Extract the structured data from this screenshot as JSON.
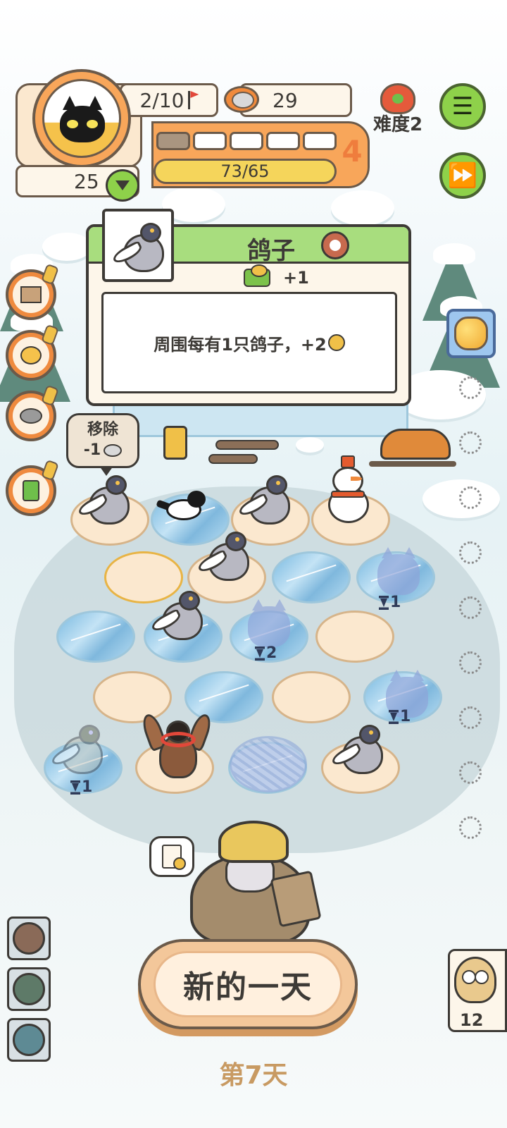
{
  "hud": {
    "level": "2/10",
    "coins": "29",
    "difficulty": "难度2",
    "week_number": "4",
    "progress": "73/65",
    "progress_fraction": 1.0,
    "week_segments_filled": 1,
    "week_segments_total": 5,
    "food": "25"
  },
  "card": {
    "title": "鸽子",
    "stat_value": "+1",
    "description": "周围每有1只鸽子，+2"
  },
  "remove_bubble": {
    "label": "移除",
    "cost": "-1"
  },
  "timers": [
    "1",
    "2",
    "1",
    "1"
  ],
  "bottom": {
    "new_day_label": "新的一天",
    "day_label": "第7天",
    "deck_count": "12"
  },
  "colors": {
    "accent_green": "#8ed14a",
    "accent_orange": "#f8a65a",
    "progress_yellow": "#f5d55b",
    "day_text": "#c89a62"
  },
  "icons": {
    "menu": "menu-list-icon",
    "fast_forward": "fast-forward-icon",
    "shop": "box-icon",
    "eggs": "eggs-icon",
    "bowl": "bowl-icon",
    "phone": "medical-device-icon"
  }
}
